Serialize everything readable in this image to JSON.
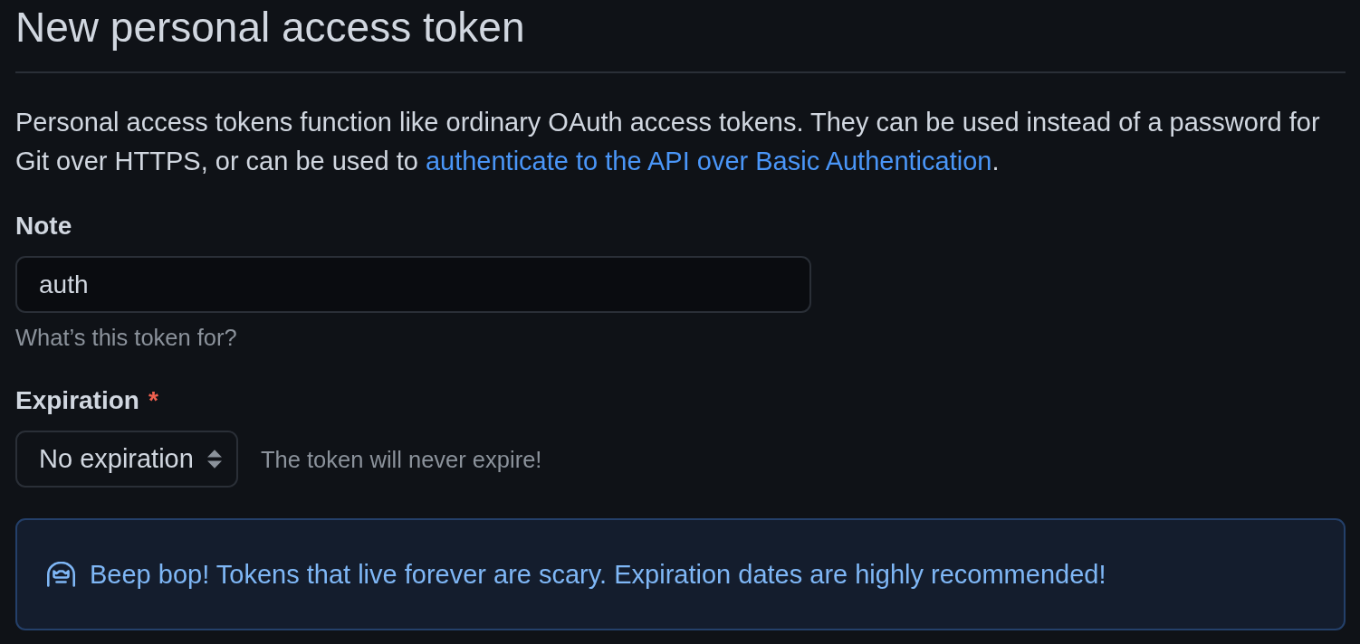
{
  "header": {
    "title": "New personal access token"
  },
  "intro": {
    "text": "Personal access tokens function like ordinary OAuth access tokens. They can be used instead of a password for Git over HTTPS, or can be used to ",
    "link": "authenticate to the API over Basic Authentication",
    "after": "."
  },
  "note_field": {
    "label": "Note",
    "value": "auth",
    "hint": "What’s this token for?"
  },
  "expiration_field": {
    "label": "Expiration",
    "required": true,
    "required_mark": "*",
    "value": "No expiration",
    "note": "The token will never expire!"
  },
  "flash": {
    "kind": "info",
    "text": "Beep bop! Tokens that live forever are scary. Expiration dates are highly recommended!"
  }
}
